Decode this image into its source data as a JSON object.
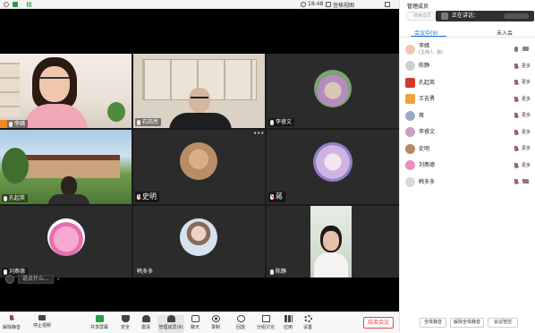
{
  "topbar": {
    "clock": "18:48",
    "view_mode": "宫格视图"
  },
  "tiles": [
    {
      "name": "李嫣",
      "host": true,
      "muted": false
    },
    {
      "name": "石岗亮",
      "muted": false
    },
    {
      "name": "李睿文",
      "muted": false
    },
    {
      "name": "孔起英",
      "muted": false
    },
    {
      "name": "史明",
      "muted": true
    },
    {
      "name": "蒋",
      "muted": true
    },
    {
      "name": "刘燕德",
      "muted": false
    },
    {
      "name": "韩多多",
      "muted": false
    },
    {
      "name": "陈静",
      "muted": false
    }
  ],
  "chat_overlay": {
    "placeholder": "说点什么..."
  },
  "toolbar": {
    "items": [
      {
        "label": "解除静音",
        "icon": "mic-muted-icon"
      },
      {
        "label": "停止视频",
        "icon": "camera-icon"
      },
      {
        "label": "共享屏幕",
        "icon": "share-screen-icon"
      },
      {
        "label": "安全",
        "icon": "shield-icon"
      },
      {
        "label": "邀请",
        "icon": "invite-icon"
      },
      {
        "label": "管理成员(9)",
        "icon": "members-icon"
      },
      {
        "label": "聊天",
        "icon": "chat-icon"
      },
      {
        "label": "录制",
        "icon": "record-icon"
      },
      {
        "label": "回放",
        "icon": "playback-icon"
      },
      {
        "label": "分组讨论",
        "icon": "breakout-icon"
      },
      {
        "label": "应用",
        "icon": "apps-icon"
      },
      {
        "label": "设置",
        "icon": "gear-icon"
      }
    ],
    "end_label": "结束会议"
  },
  "panel": {
    "title": "管理成员",
    "search_placeholder": "搜索成员",
    "speaking_label": "正在讲话：",
    "tabs": [
      "会议中(9)",
      "未入会"
    ],
    "members": [
      {
        "name": "李嫣",
        "sub": "(主持人, 我)",
        "color": "#f2c6b5",
        "muted": false,
        "more": ""
      },
      {
        "name": "陈静",
        "color": "#cfcfcf",
        "muted": true,
        "more": "更多"
      },
      {
        "name": "孔起英",
        "color": "#d23a2f",
        "muted": true,
        "more": "更多"
      },
      {
        "name": "王吉勇",
        "color": "#f0a13a",
        "muted": true,
        "more": "更多"
      },
      {
        "name": "蒋",
        "color": "#9aa8c8",
        "muted": true,
        "more": "更多"
      },
      {
        "name": "李睿文",
        "color": "#c9a0c6",
        "muted": true,
        "more": "更多"
      },
      {
        "name": "史明",
        "color": "#b08a6a",
        "muted": true,
        "more": "更多"
      },
      {
        "name": "刘燕德",
        "color": "#e98fbd",
        "muted": true,
        "more": "更多"
      },
      {
        "name": "韩多多",
        "color": "#d9d9d9",
        "muted": true,
        "more": ""
      }
    ],
    "footer": [
      "全体静音",
      "解除全体静音",
      "会议管控"
    ]
  }
}
